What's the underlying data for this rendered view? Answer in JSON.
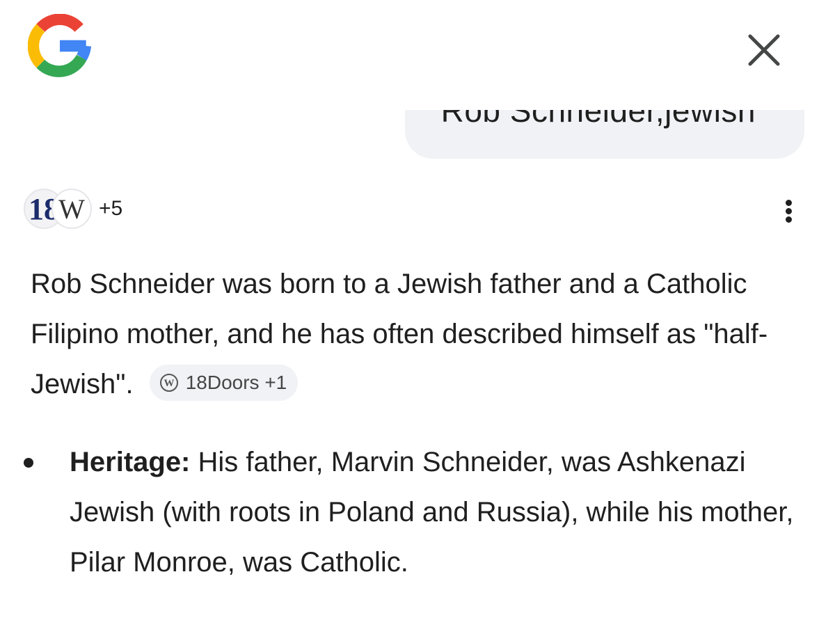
{
  "header": {
    "logo_icon": "google-g-icon",
    "close_icon": "close-icon"
  },
  "query": {
    "text": "Rob Schneider,jewish"
  },
  "sources": {
    "icons": [
      "18doors-icon",
      "wikipedia-icon"
    ],
    "icon_text_1": "18",
    "icon_text_2": "W",
    "more_count": "+5",
    "menu_icon": "more-vert-icon"
  },
  "answer": {
    "paragraph": "Rob Schneider was born to a Jewish father and a Catholic Filipino mother, and he has often described himself as \"half-Jewish\".",
    "citation_chip": {
      "icon": "wordpress-icon",
      "label": "18Doors +1"
    }
  },
  "bullets": [
    {
      "heading": "Heritage:",
      "text": " His father, Marvin Schneider, was Ashkenazi Jewish (with roots in Poland and Russia), while his mother, Pilar Monroe, was Catholic."
    }
  ],
  "colors": {
    "text": "#1f1f1f",
    "bubble": "#f0f2f5",
    "google_blue": "#4285F4",
    "google_red": "#EA4335",
    "google_yellow": "#FBBC05",
    "google_green": "#34A853"
  }
}
